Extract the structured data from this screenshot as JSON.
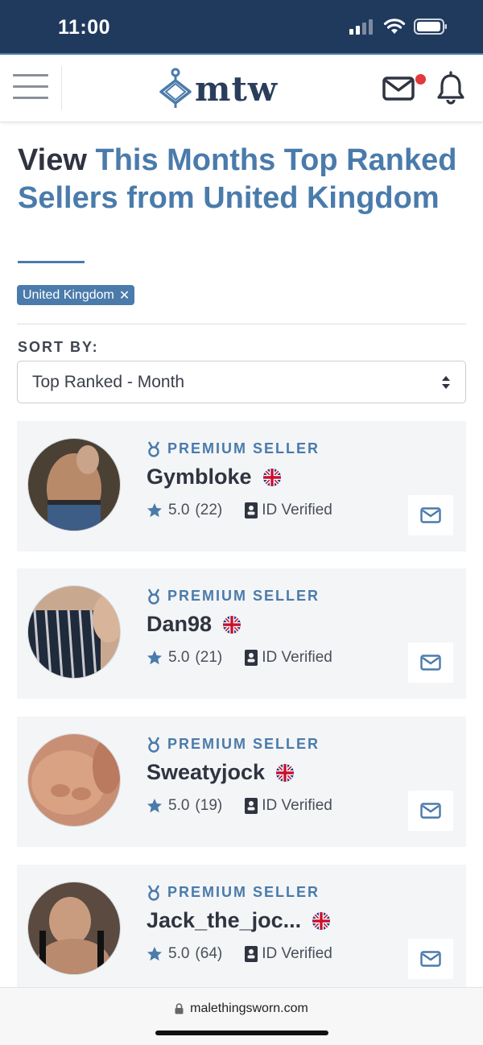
{
  "status_bar": {
    "time": "11:00"
  },
  "header": {
    "logo_text": "mtw"
  },
  "page": {
    "title_lead": "View",
    "title_rest": "This Months Top Ranked Sellers from United Kingdom",
    "filter_chip": "United Kingdom",
    "filter_chip_close": "✕",
    "sort_label": "SORT BY:",
    "sort_value": "Top Ranked - Month"
  },
  "sellers": [
    {
      "badge": "PREMIUM SELLER",
      "name": "Gymbloke",
      "rating": "5.0",
      "reviews": "(22)",
      "verified": "ID Verified"
    },
    {
      "badge": "PREMIUM SELLER",
      "name": "Dan98",
      "rating": "5.0",
      "reviews": "(21)",
      "verified": "ID Verified"
    },
    {
      "badge": "PREMIUM SELLER",
      "name": "Sweatyjock",
      "rating": "5.0",
      "reviews": "(19)",
      "verified": "ID Verified"
    },
    {
      "badge": "PREMIUM SELLER",
      "name": "Jack_the_joc...",
      "rating": "5.0",
      "reviews": "(64)",
      "verified": "ID Verified"
    }
  ],
  "browser": {
    "url": "malethingsworn.com"
  },
  "colors": {
    "status_bg": "#203a5e",
    "accent": "#4a7bab",
    "notification_dot": "#e0393e",
    "card_bg": "#f4f5f7"
  },
  "icons": {
    "menu": "hamburger-menu-icon",
    "mail": "mail-icon",
    "bell": "bell-icon",
    "badge": "medal-icon",
    "flag": "uk-flag-icon",
    "star": "star-icon",
    "verified": "id-card-icon",
    "message": "envelope-icon",
    "lock": "lock-icon"
  }
}
